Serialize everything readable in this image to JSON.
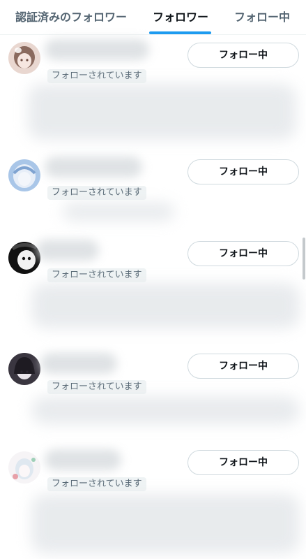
{
  "tabs": [
    {
      "label": "認証済みのフォロワー",
      "active": false
    },
    {
      "label": "フォロワー",
      "active": true
    },
    {
      "label": "フォロー中",
      "active": false
    }
  ],
  "users": [
    {
      "follows_you_label": "フォローされています",
      "button_label": "フォロー中",
      "avatar_icon": "avatar-girl-brown-hair"
    },
    {
      "follows_you_label": "フォローされています",
      "button_label": "フォロー中",
      "avatar_icon": "avatar-blue-anime"
    },
    {
      "follows_you_label": "フォローされています",
      "button_label": "フォロー中",
      "avatar_icon": "avatar-monochrome"
    },
    {
      "follows_you_label": "フォローされています",
      "button_label": "フォロー中",
      "avatar_icon": "avatar-dark-hair-girl"
    },
    {
      "follows_you_label": "フォローされています",
      "button_label": "フォロー中",
      "avatar_icon": "avatar-flower-girl"
    }
  ],
  "colors": {
    "accent": "#1d9bf0",
    "text_primary": "#0f1419",
    "text_secondary": "#536471",
    "border": "#cfd9de"
  }
}
